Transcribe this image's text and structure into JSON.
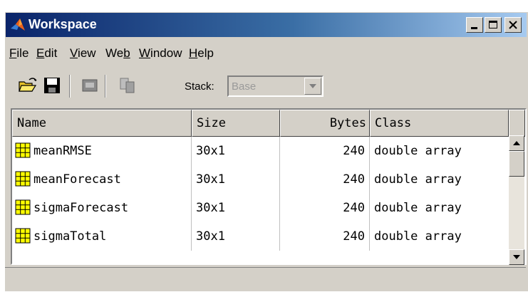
{
  "window": {
    "title": "Workspace"
  },
  "menu": [
    {
      "pre": "",
      "ul": "F",
      "post": "ile"
    },
    {
      "pre": "",
      "ul": "E",
      "post": "dit"
    },
    {
      "pre": "",
      "ul": "V",
      "post": "iew"
    },
    {
      "pre": "We",
      "ul": "b",
      "post": ""
    },
    {
      "pre": "",
      "ul": "W",
      "post": "indow"
    },
    {
      "pre": "",
      "ul": "H",
      "post": "elp"
    }
  ],
  "toolbar": {
    "icons": [
      "open-folder-icon",
      "save-icon",
      "print-icon",
      "copy-icon"
    ],
    "stack_label": "Stack:",
    "stack_value": "Base"
  },
  "table": {
    "columns": [
      "Name",
      "Size",
      "Bytes",
      "Class"
    ],
    "rows": [
      {
        "name": "meanRMSE",
        "size": "30x1",
        "bytes": "240",
        "class": "double array"
      },
      {
        "name": "meanForecast",
        "size": "30x1",
        "bytes": "240",
        "class": "double array"
      },
      {
        "name": "sigmaForecast",
        "size": "30x1",
        "bytes": "240",
        "class": "double array"
      },
      {
        "name": "sigmaTotal",
        "size": "30x1",
        "bytes": "240",
        "class": "double array"
      }
    ]
  },
  "colors": {
    "title_active": "#0a246a",
    "chrome": "#d4d0c8",
    "variable_icon": "#ffff00"
  }
}
